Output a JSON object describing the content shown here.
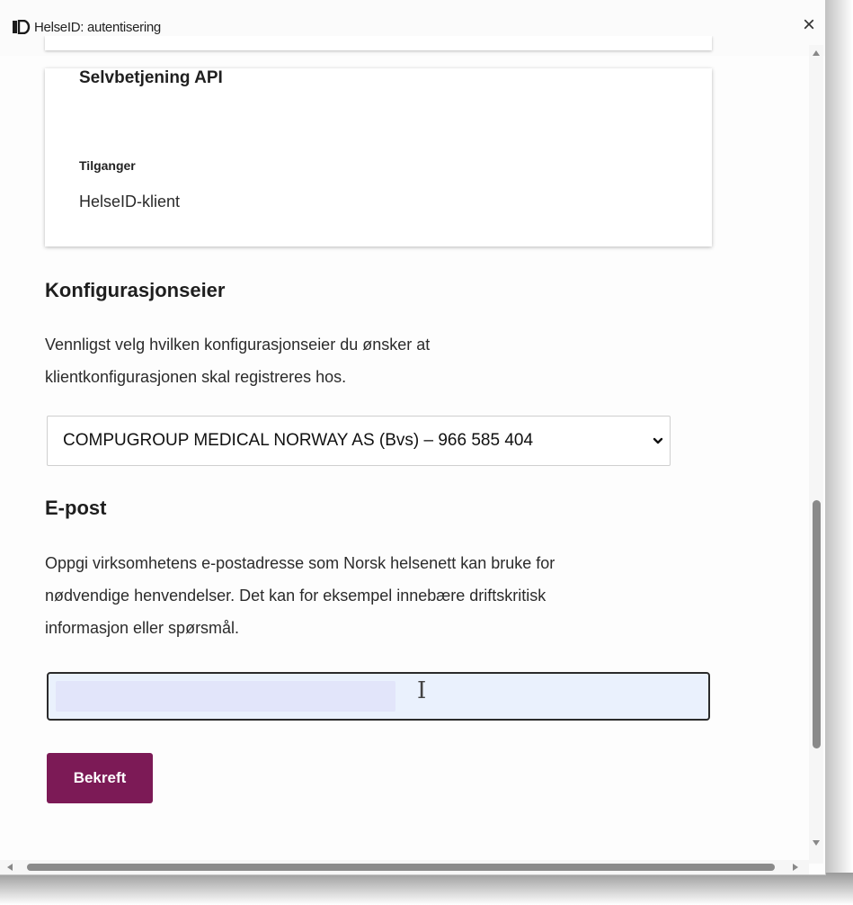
{
  "window": {
    "title": "HelseID: autentisering",
    "close_icon": "close-icon",
    "close_label": "×"
  },
  "card": {
    "title": "Selvbetjening API",
    "access_label": "Tilganger",
    "access_value": "HelseID-klient"
  },
  "config_owner": {
    "heading": "Konfigurasjonseier",
    "description_line1": "Vennligst velg hvilken konfigurasjonseier du ønsker at",
    "description_line2": "klientkonfigurasjonen skal registreres hos.",
    "selected_value": "COMPUGROUP MEDICAL NORWAY AS (Bvs) – 966 585 404"
  },
  "email": {
    "heading": "E-post",
    "description_line1": "Oppgi virksomhetens e-postadresse som Norsk helsenett kan bruke for",
    "description_line2": "nødvendige henvendelser. Det kan for eksempel innebære driftskritisk",
    "description_line3": "informasjon eller spørsmål.",
    "value": "",
    "cursor_glyph": "I"
  },
  "actions": {
    "confirm_label": "Bekreft"
  },
  "colors": {
    "primary_button": "#7c1a56",
    "input_background": "#eaf1fd"
  }
}
